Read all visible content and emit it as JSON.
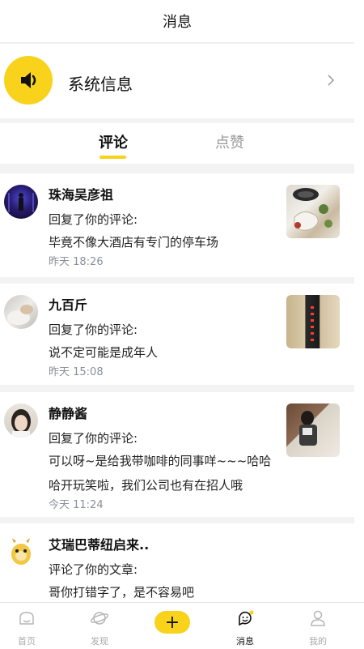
{
  "header": {
    "title": "消息"
  },
  "system": {
    "label": "系统信息"
  },
  "tabs": [
    {
      "label": "评论",
      "active": true
    },
    {
      "label": "点赞",
      "active": false
    }
  ],
  "messages": [
    {
      "name": "珠海吴彦祖",
      "action": "回复了你的评论:",
      "lines": [
        "毕竟不像大酒店有专门的停车场"
      ],
      "time": "昨天 18:26"
    },
    {
      "name": "九百斤",
      "action": "回复了你的评论:",
      "lines": [
        "说不定可能是成年人"
      ],
      "time": "昨天 15:08"
    },
    {
      "name": "静静酱",
      "action": "回复了你的评论:",
      "lines": [
        "可以呀~是给我带咖啡的同事咩~~~哈哈",
        "哈开玩笑啦，我们公司也有在招人哦"
      ],
      "time": "今天 11:24"
    },
    {
      "name": "艾瑞巴蒂纽启来..",
      "action": "评论了你的文章:",
      "lines": [
        "哥你打错字了，是不容易吧"
      ],
      "time": ""
    }
  ],
  "tabbar": {
    "items": [
      {
        "label": "首页",
        "icon": "home-icon",
        "active": false
      },
      {
        "label": "发现",
        "icon": "planet-icon",
        "active": false
      },
      {
        "label": "+",
        "icon": "plus-icon",
        "active": false
      },
      {
        "label": "消息",
        "icon": "message-icon",
        "active": true
      },
      {
        "label": "我的",
        "icon": "profile-icon",
        "active": false
      }
    ]
  },
  "colors": {
    "accent": "#f8d21b",
    "time": "#8a8f99",
    "background": "#f3f3f3"
  }
}
